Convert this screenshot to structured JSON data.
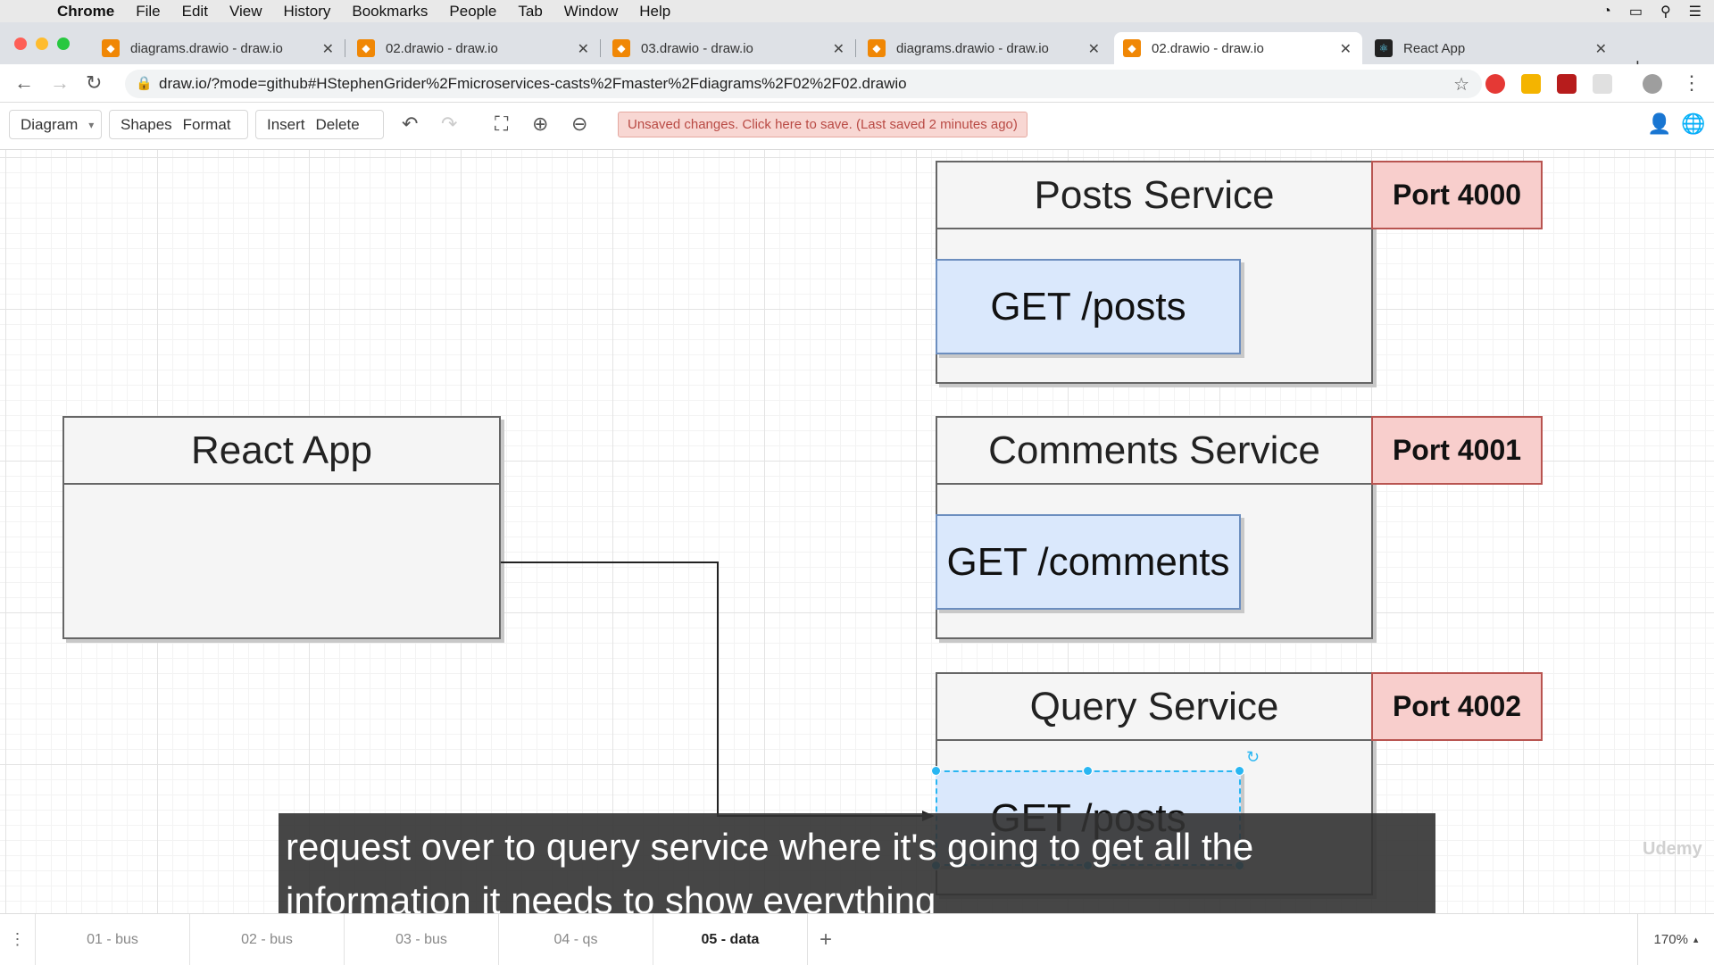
{
  "menubar": {
    "app": "Chrome",
    "items": [
      "File",
      "Edit",
      "View",
      "History",
      "Bookmarks",
      "People",
      "Tab",
      "Window",
      "Help"
    ]
  },
  "tabs": [
    {
      "title": "diagrams.drawio - draw.io",
      "icon": "drawio-icon"
    },
    {
      "title": "02.drawio - draw.io",
      "icon": "drawio-icon"
    },
    {
      "title": "03.drawio - draw.io",
      "icon": "drawio-icon"
    },
    {
      "title": "diagrams.drawio - draw.io",
      "icon": "drawio-icon"
    },
    {
      "title": "02.drawio - draw.io",
      "icon": "drawio-icon",
      "active": true
    },
    {
      "title": "React App",
      "icon": "react-icon"
    }
  ],
  "address": {
    "url": "draw.io/?mode=github#HStephenGrider%2Fmicroservices-casts%2Fmaster%2Fdiagrams%2F02%2F02.drawio"
  },
  "toolbar": {
    "diagram": "Diagram",
    "shapes": "Shapes",
    "format": "Format",
    "insert": "Insert",
    "delete": "Delete",
    "unsaved": "Unsaved changes. Click here to save. (Last saved 2 minutes ago)"
  },
  "diagram": {
    "react_app": "React App",
    "services": [
      {
        "name": "Posts Service",
        "port": "Port 4000",
        "route": "GET /posts"
      },
      {
        "name": "Comments Service",
        "port": "Port 4001",
        "route": "GET /comments"
      },
      {
        "name": "Query Service",
        "port": "Port 4002",
        "route": "GET /posts"
      }
    ],
    "colors": {
      "port_fill": "#f8cecc",
      "route_fill": "#dae8fc",
      "box_fill": "#f5f5f5",
      "selection": "#29b6f2"
    }
  },
  "subtitle": {
    "line1": "request over to query service where it's going to get all the",
    "line2": "information it needs to show everything"
  },
  "watermark": "Udemy",
  "pages": [
    "01 - bus",
    "02 - bus",
    "03 - bus",
    "04 - qs",
    "05 - data"
  ],
  "active_page": "05 - data",
  "zoom": "170%"
}
